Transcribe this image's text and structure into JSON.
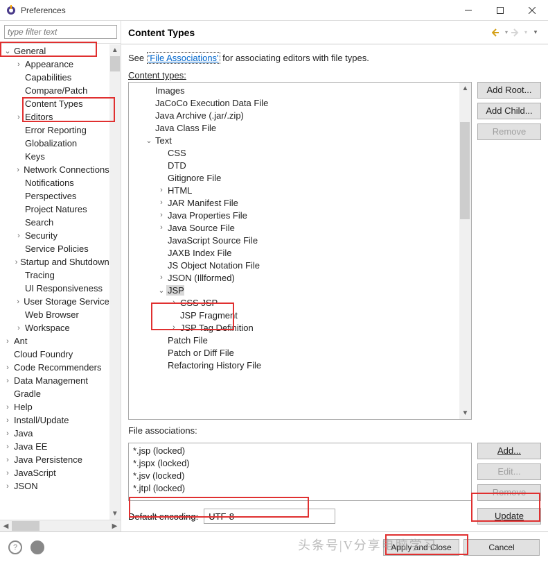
{
  "window": {
    "title": "Preferences",
    "filter_placeholder": "type filter text"
  },
  "sidebar": {
    "items": [
      {
        "label": "General",
        "level": 1,
        "tw": "v"
      },
      {
        "label": "Appearance",
        "level": 2,
        "tw": ">"
      },
      {
        "label": "Capabilities",
        "level": 2,
        "tw": ""
      },
      {
        "label": "Compare/Patch",
        "level": 2,
        "tw": ""
      },
      {
        "label": "Content Types",
        "level": 2,
        "tw": ""
      },
      {
        "label": "Editors",
        "level": 2,
        "tw": ">"
      },
      {
        "label": "Error Reporting",
        "level": 2,
        "tw": ""
      },
      {
        "label": "Globalization",
        "level": 2,
        "tw": ""
      },
      {
        "label": "Keys",
        "level": 2,
        "tw": ""
      },
      {
        "label": "Network Connections",
        "level": 2,
        "tw": ">"
      },
      {
        "label": "Notifications",
        "level": 2,
        "tw": ""
      },
      {
        "label": "Perspectives",
        "level": 2,
        "tw": ""
      },
      {
        "label": "Project Natures",
        "level": 2,
        "tw": ""
      },
      {
        "label": "Search",
        "level": 2,
        "tw": ""
      },
      {
        "label": "Security",
        "level": 2,
        "tw": ">"
      },
      {
        "label": "Service Policies",
        "level": 2,
        "tw": ""
      },
      {
        "label": "Startup and Shutdown",
        "level": 2,
        "tw": ">"
      },
      {
        "label": "Tracing",
        "level": 2,
        "tw": ""
      },
      {
        "label": "UI Responsiveness",
        "level": 2,
        "tw": ""
      },
      {
        "label": "User Storage Service",
        "level": 2,
        "tw": ">"
      },
      {
        "label": "Web Browser",
        "level": 2,
        "tw": ""
      },
      {
        "label": "Workspace",
        "level": 2,
        "tw": ">"
      },
      {
        "label": "Ant",
        "level": 1,
        "tw": ">"
      },
      {
        "label": "Cloud Foundry",
        "level": 1,
        "tw": ""
      },
      {
        "label": "Code Recommenders",
        "level": 1,
        "tw": ">"
      },
      {
        "label": "Data Management",
        "level": 1,
        "tw": ">"
      },
      {
        "label": "Gradle",
        "level": 1,
        "tw": ""
      },
      {
        "label": "Help",
        "level": 1,
        "tw": ">"
      },
      {
        "label": "Install/Update",
        "level": 1,
        "tw": ">"
      },
      {
        "label": "Java",
        "level": 1,
        "tw": ">"
      },
      {
        "label": "Java EE",
        "level": 1,
        "tw": ">"
      },
      {
        "label": "Java Persistence",
        "level": 1,
        "tw": ">"
      },
      {
        "label": "JavaScript",
        "level": 1,
        "tw": ">"
      },
      {
        "label": "JSON",
        "level": 1,
        "tw": ">"
      }
    ]
  },
  "content": {
    "heading": "Content Types",
    "see_prefix": "See ",
    "file_associations_link": "'File Associations'",
    "see_suffix": " for associating editors with file types.",
    "content_types_label": "Content types:",
    "file_associations_label": "File associations:",
    "default_encoding_label": "Default encoding:",
    "encoding_value": "UTF-8",
    "tree": [
      {
        "label": "Images",
        "level": 1,
        "tw": ""
      },
      {
        "label": "JaCoCo Execution Data File",
        "level": 1,
        "tw": ""
      },
      {
        "label": "Java Archive (.jar/.zip)",
        "level": 1,
        "tw": ""
      },
      {
        "label": "Java Class File",
        "level": 1,
        "tw": ""
      },
      {
        "label": "Text",
        "level": 1,
        "tw": "v"
      },
      {
        "label": "CSS",
        "level": 2,
        "tw": ""
      },
      {
        "label": "DTD",
        "level": 2,
        "tw": ""
      },
      {
        "label": "Gitignore File",
        "level": 2,
        "tw": ""
      },
      {
        "label": "HTML",
        "level": 2,
        "tw": ">"
      },
      {
        "label": "JAR Manifest File",
        "level": 2,
        "tw": ">"
      },
      {
        "label": "Java Properties File",
        "level": 2,
        "tw": ">"
      },
      {
        "label": "Java Source File",
        "level": 2,
        "tw": ">"
      },
      {
        "label": "JavaScript Source File",
        "level": 2,
        "tw": ""
      },
      {
        "label": "JAXB Index File",
        "level": 2,
        "tw": ""
      },
      {
        "label": "JS Object Notation File",
        "level": 2,
        "tw": ""
      },
      {
        "label": "JSON (Illformed)",
        "level": 2,
        "tw": ">"
      },
      {
        "label": "JSP",
        "level": 2,
        "tw": "v",
        "sel": true
      },
      {
        "label": "CSS JSP",
        "level": 3,
        "tw": ">"
      },
      {
        "label": "JSP Fragment",
        "level": 3,
        "tw": ""
      },
      {
        "label": "JSP Tag Definition",
        "level": 3,
        "tw": ">"
      },
      {
        "label": "Patch File",
        "level": 2,
        "tw": ""
      },
      {
        "label": "Patch or Diff File",
        "level": 2,
        "tw": ""
      },
      {
        "label": "Refactoring History File",
        "level": 2,
        "tw": ""
      }
    ],
    "file_assoc": [
      "*.jsp (locked)",
      "*.jspx (locked)",
      "*.jsv (locked)",
      "*.jtpl (locked)"
    ],
    "buttons": {
      "add_root": "Add Root...",
      "add_child": "Add Child...",
      "remove_ct": "Remove",
      "add_assoc": "Add...",
      "edit_assoc": "Edit...",
      "remove_assoc": "Remove",
      "update": "Update",
      "apply_close": "Apply and Close",
      "cancel": "Cancel"
    }
  },
  "watermark": "头条号|V分享电脑学习"
}
